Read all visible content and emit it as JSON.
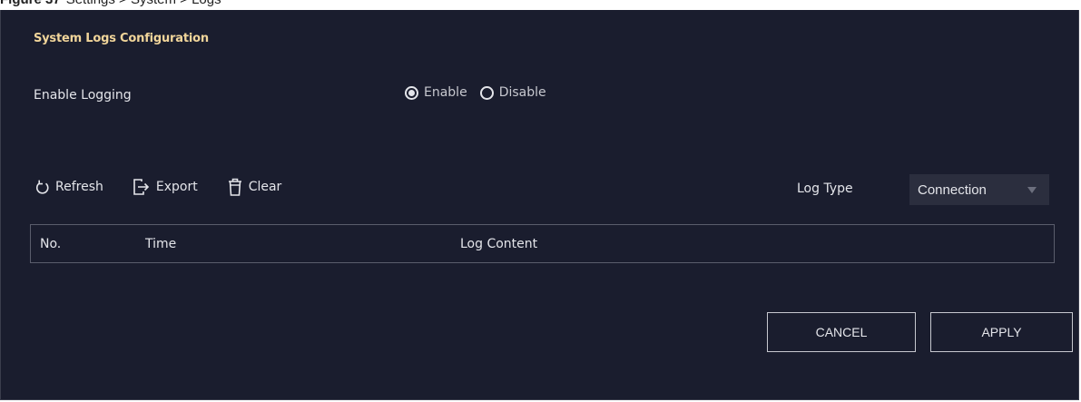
{
  "figure_caption": {
    "label": "Figure 37",
    "text": "Settings > System > Logs"
  },
  "panel": {
    "title": "System Logs Configuration",
    "enable_logging": {
      "label": "Enable Logging",
      "options": [
        {
          "label": "Enable",
          "selected": true
        },
        {
          "label": "Disable",
          "selected": false
        }
      ]
    },
    "toolbar": {
      "refresh_label": "Refresh",
      "export_label": "Export",
      "clear_label": "Clear"
    },
    "log_type": {
      "label": "Log Type",
      "selected": "Connection"
    },
    "table": {
      "columns": [
        "No.",
        "Time",
        "Log Content"
      ]
    },
    "buttons": {
      "cancel_label": "CANCEL",
      "apply_label": "APPLY"
    }
  },
  "colors": {
    "background": "#1a1d2e",
    "title": "#f1d59a",
    "text": "#e4e5ea",
    "select_bg": "#2b2e3e"
  }
}
